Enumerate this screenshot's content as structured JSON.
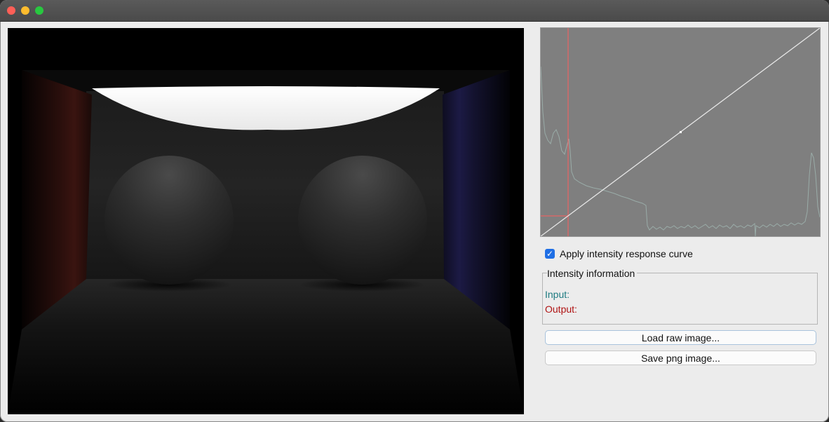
{
  "window": {
    "controls": [
      "close-button",
      "minimize-button",
      "zoom-button"
    ]
  },
  "curve_panel": {
    "marker_icon": "crosshair-marker",
    "colors": {
      "background": "#7f7f7f",
      "histogram": "#9aaca8",
      "curve": "#e6e6e6",
      "marker": "#ff5c5c"
    }
  },
  "apply_curve": {
    "label": "Apply intensity response curve",
    "checked": true
  },
  "intensity_info": {
    "title": "Intensity information",
    "input_label": "Input:",
    "output_label": "Output:"
  },
  "buttons": {
    "load_label": "Load raw image...",
    "save_label": "Save png image..."
  }
}
